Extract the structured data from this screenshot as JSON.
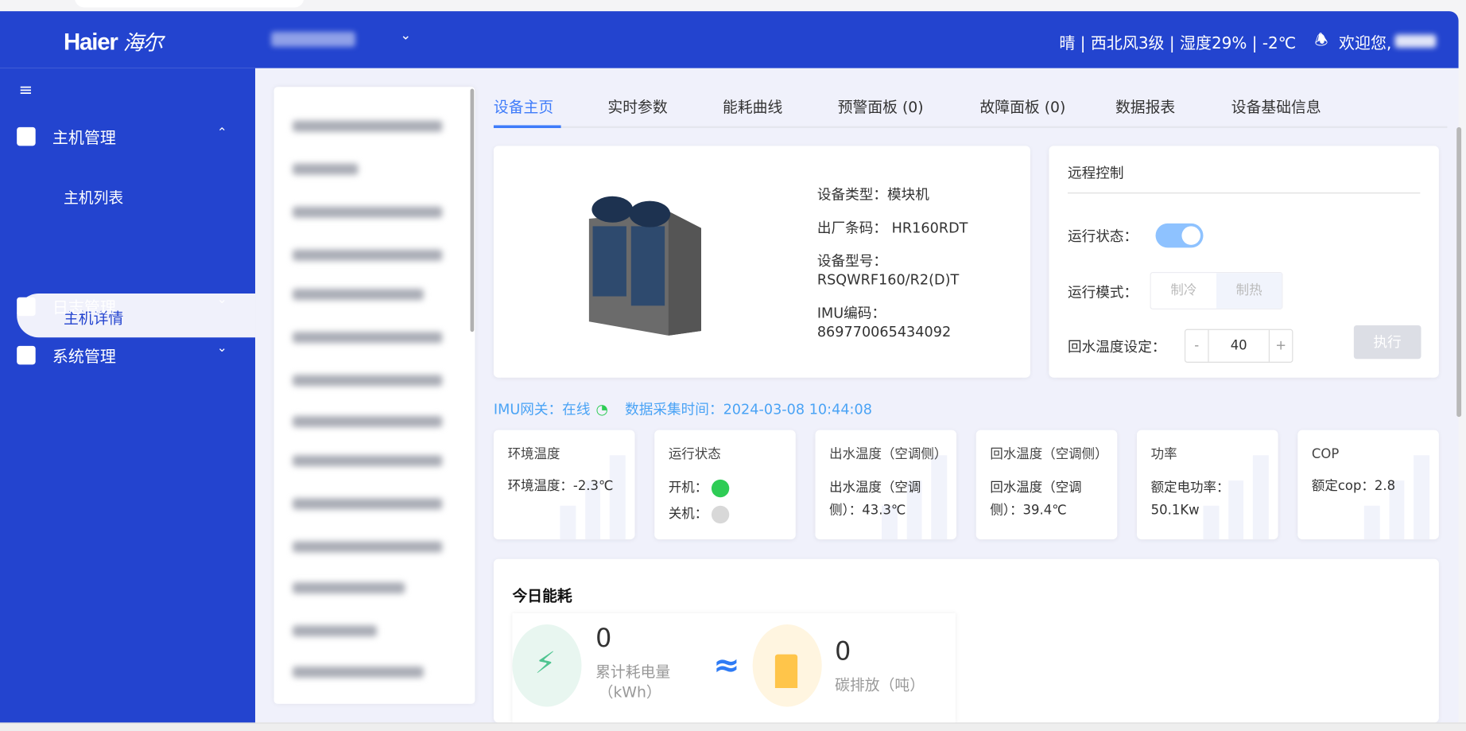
{
  "header": {
    "logo": "Haier",
    "logo_cn": "海尔",
    "weather": "晴 | 西北风3级 | 湿度29% | -2℃",
    "welcome": "欢迎您,"
  },
  "sidebar": {
    "items": [
      {
        "label": "主机管理",
        "icon": "home-icon",
        "expanded": true,
        "children": [
          {
            "label": "主机列表"
          },
          {
            "label": "主机详情",
            "active": true
          }
        ]
      },
      {
        "label": "日志管理",
        "icon": "log-icon"
      },
      {
        "label": "系统管理",
        "icon": "grid-icon"
      }
    ]
  },
  "tabs": [
    {
      "label": "设备主页",
      "active": true
    },
    {
      "label": "实时参数"
    },
    {
      "label": "能耗曲线"
    },
    {
      "label": "预警面板 (0)"
    },
    {
      "label": "故障面板 (0)"
    },
    {
      "label": "数据报表"
    },
    {
      "label": "设备基础信息"
    }
  ],
  "device": {
    "type": "设备类型：模块机",
    "barcode": "出厂条码：  HR160RDT",
    "model_label": "设备型号：",
    "model": "RSQWRF160/R2(D)T",
    "imu_label": "IMU编码：",
    "imu": "869770065434092"
  },
  "remote": {
    "title": "远程控制",
    "run_status": "运行状态：",
    "run_on": true,
    "mode_label": "运行模式：",
    "modes": [
      "制冷",
      "制热"
    ],
    "temp_label": "回水温度设定：",
    "temp_minus": "-",
    "temp_value": "40",
    "temp_plus": "+",
    "exec": "执行"
  },
  "status": {
    "gateway": "IMU网关：在线",
    "time": "数据采集时间：2024-03-08 10:44:08"
  },
  "metrics": [
    {
      "title": "环境温度",
      "value": "环境温度：-2.3℃"
    },
    {
      "title": "运行状态",
      "on": "开机：",
      "off": "关机："
    },
    {
      "title": "出水温度（空调侧）",
      "value": "出水温度（空调侧）：43.3℃"
    },
    {
      "title": "回水温度（空调侧）",
      "value": "回水温度（空调侧）：39.4℃"
    },
    {
      "title": "功率",
      "value": "额定电功率：50.1Kw"
    },
    {
      "title": "COP",
      "value": "额定cop：2.8"
    }
  ],
  "energy": {
    "title": "今日能耗",
    "power_value": "0",
    "power_label": "累计耗电量",
    "power_unit": "（kWh）",
    "approx": "≈",
    "carbon_value": "0",
    "carbon_label": "碳排放（吨）"
  },
  "colors": {
    "primary": "#2344cf",
    "accent": "#3e7bfa",
    "on": "#2ecc55",
    "off": "#d8d8d8"
  }
}
